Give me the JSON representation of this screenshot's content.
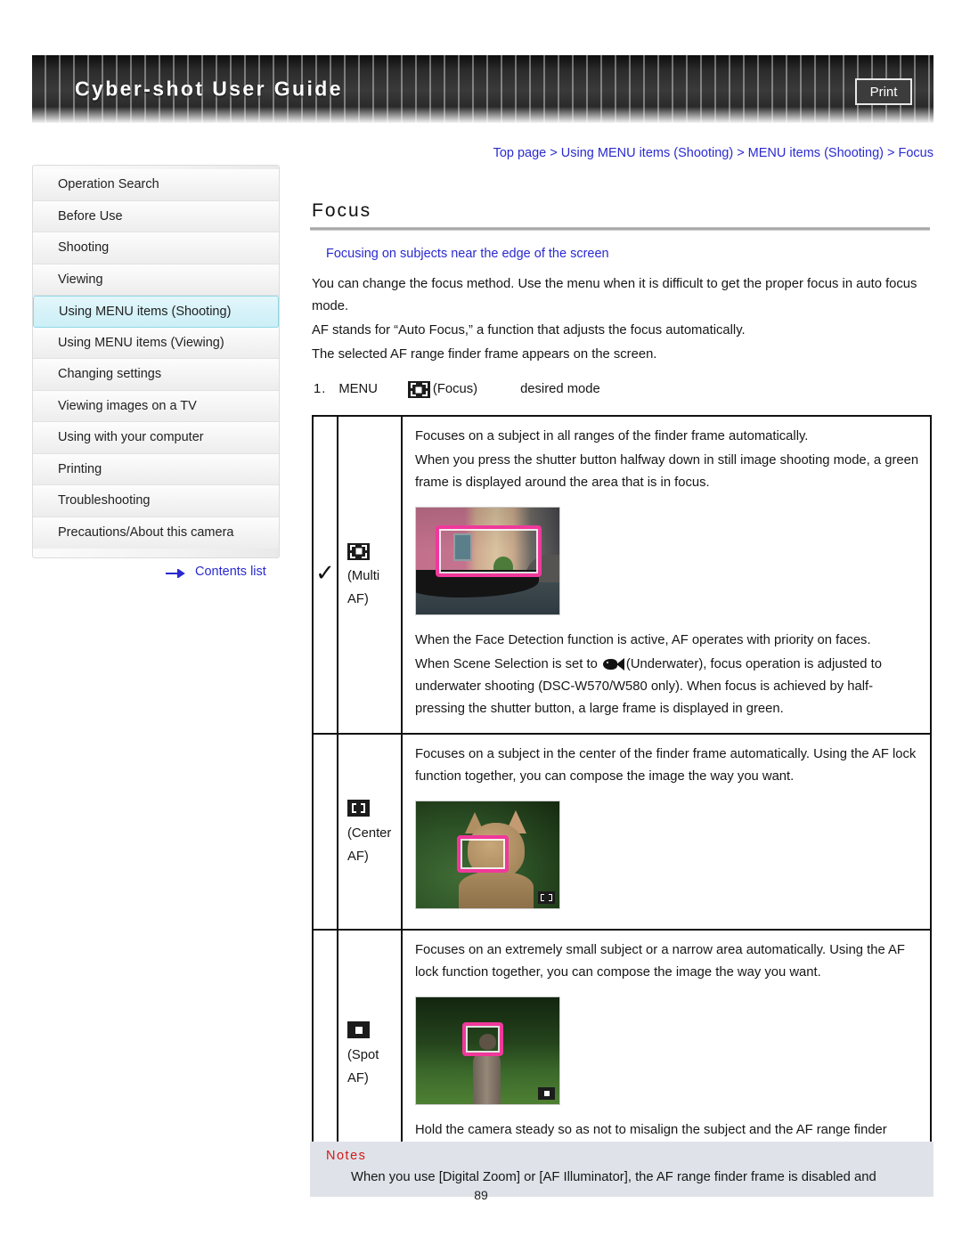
{
  "header": {
    "title": "Cyber-shot User Guide",
    "print_label": "Print"
  },
  "breadcrumb": {
    "text": "Top page > Using MENU items (Shooting) > MENU items (Shooting) > Focus"
  },
  "sidebar": {
    "items": [
      {
        "label": "Operation Search",
        "active": false
      },
      {
        "label": "Before Use",
        "active": false
      },
      {
        "label": "Shooting",
        "active": false
      },
      {
        "label": "Viewing",
        "active": false
      },
      {
        "label": "Using MENU items (Shooting)",
        "active": true
      },
      {
        "label": "Using MENU items (Viewing)",
        "active": false
      },
      {
        "label": "Changing settings",
        "active": false
      },
      {
        "label": "Viewing images on a TV",
        "active": false
      },
      {
        "label": "Using with your computer",
        "active": false
      },
      {
        "label": "Printing",
        "active": false
      },
      {
        "label": "Troubleshooting",
        "active": false
      },
      {
        "label": "Precautions/About this camera",
        "active": false
      }
    ],
    "contents_link": "Contents list"
  },
  "main": {
    "title": "Focus",
    "sub_link": "Focusing on subjects near the edge of the screen",
    "intro_line1": "You can change the focus method. Use the menu when it is difficult to get the proper focus in auto focus mode.",
    "intro_line2": "AF stands for “Auto Focus,” a function that adjusts the focus automatically.",
    "intro_line3": "The selected AF range finder frame appears on the screen.",
    "step": {
      "number": "1.",
      "menu": "MENU",
      "focus_label": "(Focus)",
      "desired": "desired mode"
    }
  },
  "table": {
    "rows": [
      {
        "checked": "✓",
        "icon": "multi-af-icon",
        "mode_line1": "(Multi",
        "mode_line2": "AF)",
        "desc_top": [
          "Focuses on a subject in all ranges of the finder frame automatically.",
          "When you press the shutter button halfway down in still image shooting mode, a green frame is displayed around the area that is in focus."
        ],
        "image": "venice-gondola-thumbnail",
        "desc_bottom_1": "When the Face Detection function is active, AF operates with priority on faces.",
        "desc_bottom_2a": "When Scene Selection is set to ",
        "desc_bottom_2b": "(Underwater), focus operation is adjusted to underwater shooting (DSC-W570/W580 only). When focus is achieved by half-pressing the shutter button, a large frame is displayed in green."
      },
      {
        "checked": "",
        "icon": "center-af-icon",
        "mode_line1": "(Center",
        "mode_line2": "AF)",
        "desc_top": [
          "Focuses on a subject in the center of the finder frame automatically. Using the AF lock function together, you can compose the image the way you want."
        ],
        "image": "cat-thumbnail",
        "desc_bottom_1": "",
        "desc_bottom_2a": "",
        "desc_bottom_2b": ""
      },
      {
        "checked": "",
        "icon": "spot-af-icon",
        "mode_line1": "(Spot",
        "mode_line2": "AF)",
        "desc_top": [
          "Focuses on an extremely small subject or a narrow area automatically. Using the AF lock function together, you can compose the image the way you want."
        ],
        "image": "bird-post-thumbnail",
        "desc_bottom_1": "Hold the camera steady so as not to misalign the subject and the AF range finder frame.",
        "desc_bottom_2a": "",
        "desc_bottom_2b": ""
      }
    ]
  },
  "notes": {
    "title": "Notes",
    "body": "When you use [Digital Zoom] or [AF Illuminator], the AF range finder frame is disabled and"
  },
  "footer": {
    "page_number": "89"
  },
  "colors": {
    "link": "#2a2ad0",
    "active_nav": "#ccf0f7",
    "af_frame": "#f0389b",
    "notes_title": "#d11a1a",
    "notes_bg": "#dfe3e9"
  }
}
